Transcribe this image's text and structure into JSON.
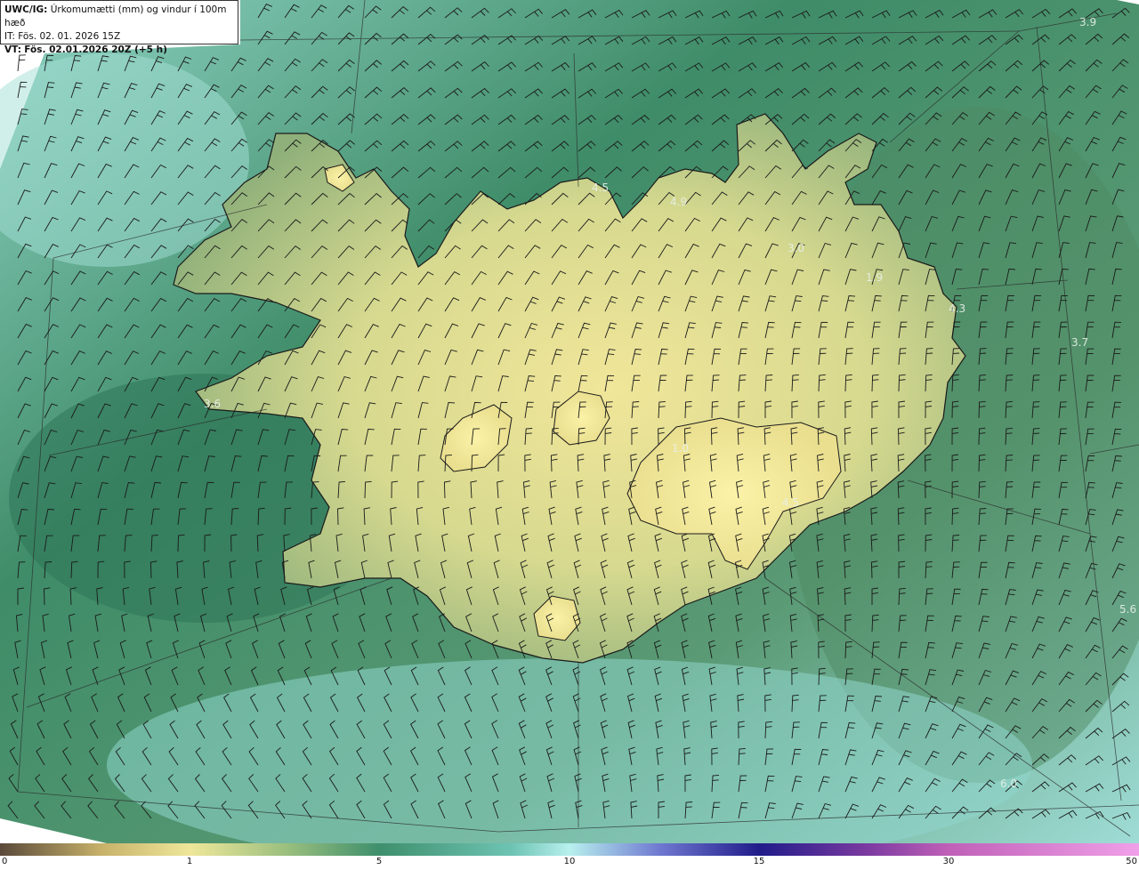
{
  "header": {
    "product": "UWC/IG:",
    "description": "Úrkomumætti (mm) og vindur í 100m hæð",
    "init_time": "IT: Fös. 02. 01. 2026 15Z",
    "valid_prefix": "VT:",
    "valid_time": "Fös. 02.01.2026 20Z (+5 h)"
  },
  "colorbar": {
    "ticks": [
      "0",
      "1",
      "5",
      "10",
      "15",
      "30",
      "50"
    ],
    "colors": [
      "#5a4a3a",
      "#c8b26a",
      "#efe79a",
      "#3e8f6c",
      "#b8f0ee",
      "#6e78d0",
      "#201c8a",
      "#c060b8",
      "#f0a0e8"
    ]
  },
  "map_labels": [
    "3.9",
    "4.5",
    "4.9",
    "3.0",
    "1.9",
    "4.3",
    "3.7",
    "3.6",
    "1.0",
    "4.5",
    "5.6",
    "6.0"
  ],
  "map_colors": {
    "land_high": "#f1e69a",
    "land_mid": "#b5c98a",
    "coast_green": "#2f7a5c",
    "sea_deep": "#3a7a5c",
    "sea_light": "#a8e6dc",
    "outline": "#1a1a1a"
  }
}
